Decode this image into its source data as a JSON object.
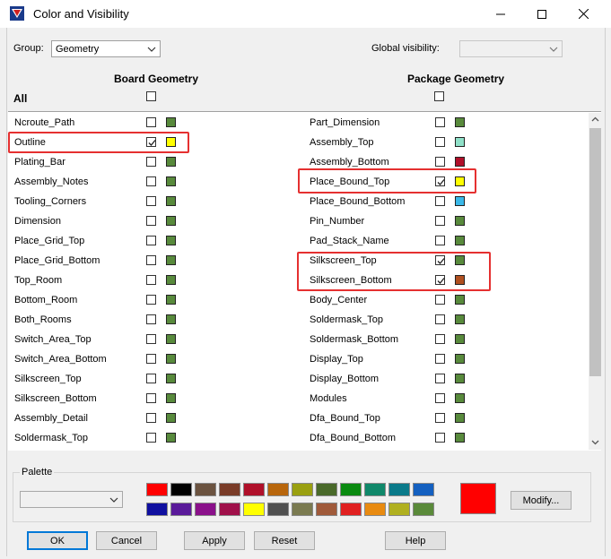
{
  "window": {
    "title": "Color and Visibility"
  },
  "group": {
    "label": "Group:",
    "value": "Geometry"
  },
  "global_visibility": {
    "label": "Global visibility:",
    "value": ""
  },
  "headers": {
    "left": "Board Geometry",
    "right": "Package Geometry",
    "all": "All"
  },
  "left_items": [
    {
      "label": "Ncroute_Path",
      "checked": false,
      "color": "#588a3c"
    },
    {
      "label": "Outline",
      "checked": true,
      "color": "#ffff00"
    },
    {
      "label": "Plating_Bar",
      "checked": false,
      "color": "#588a3c"
    },
    {
      "label": "Assembly_Notes",
      "checked": false,
      "color": "#588a3c"
    },
    {
      "label": "Tooling_Corners",
      "checked": false,
      "color": "#588a3c"
    },
    {
      "label": "Dimension",
      "checked": false,
      "color": "#588a3c"
    },
    {
      "label": "Place_Grid_Top",
      "checked": false,
      "color": "#588a3c"
    },
    {
      "label": "Place_Grid_Bottom",
      "checked": false,
      "color": "#588a3c"
    },
    {
      "label": "Top_Room",
      "checked": false,
      "color": "#588a3c"
    },
    {
      "label": "Bottom_Room",
      "checked": false,
      "color": "#588a3c"
    },
    {
      "label": "Both_Rooms",
      "checked": false,
      "color": "#588a3c"
    },
    {
      "label": "Switch_Area_Top",
      "checked": false,
      "color": "#588a3c"
    },
    {
      "label": "Switch_Area_Bottom",
      "checked": false,
      "color": "#588a3c"
    },
    {
      "label": "Silkscreen_Top",
      "checked": false,
      "color": "#588a3c"
    },
    {
      "label": "Silkscreen_Bottom",
      "checked": false,
      "color": "#588a3c"
    },
    {
      "label": "Assembly_Detail",
      "checked": false,
      "color": "#588a3c"
    },
    {
      "label": "Soldermask_Top",
      "checked": false,
      "color": "#588a3c"
    }
  ],
  "right_items": [
    {
      "label": "Part_Dimension",
      "checked": false,
      "color": "#588a3c"
    },
    {
      "label": "Assembly_Top",
      "checked": false,
      "color": "#8fe0c8"
    },
    {
      "label": "Assembly_Bottom",
      "checked": false,
      "color": "#b0102a"
    },
    {
      "label": "Place_Bound_Top",
      "checked": true,
      "color": "#ffff00"
    },
    {
      "label": "Place_Bound_Bottom",
      "checked": false,
      "color": "#3ab8e8"
    },
    {
      "label": "Pin_Number",
      "checked": false,
      "color": "#588a3c"
    },
    {
      "label": "Pad_Stack_Name",
      "checked": false,
      "color": "#588a3c"
    },
    {
      "label": "Silkscreen_Top",
      "checked": true,
      "color": "#588a3c"
    },
    {
      "label": "Silkscreen_Bottom",
      "checked": true,
      "color": "#b05020"
    },
    {
      "label": "Body_Center",
      "checked": false,
      "color": "#588a3c"
    },
    {
      "label": "Soldermask_Top",
      "checked": false,
      "color": "#588a3c"
    },
    {
      "label": "Soldermask_Bottom",
      "checked": false,
      "color": "#588a3c"
    },
    {
      "label": "Display_Top",
      "checked": false,
      "color": "#588a3c"
    },
    {
      "label": "Display_Bottom",
      "checked": false,
      "color": "#588a3c"
    },
    {
      "label": "Modules",
      "checked": false,
      "color": "#588a3c"
    },
    {
      "label": "Dfa_Bound_Top",
      "checked": false,
      "color": "#588a3c"
    },
    {
      "label": "Dfa_Bound_Bottom",
      "checked": false,
      "color": "#588a3c"
    }
  ],
  "palette": {
    "label": "Palette",
    "row1": [
      "#ff0000",
      "#000000",
      "#6b5340",
      "#7a3c28",
      "#b0102a",
      "#b8660c",
      "#9aa010",
      "#4a6a2a",
      "#0a8a10",
      "#10886a",
      "#0a7a8a",
      "#1460c0"
    ],
    "row2": [
      "#1010a0",
      "#5a1a9a",
      "#8a108a",
      "#a0104a",
      "#ffff00",
      "#505050",
      "#7a7a50",
      "#a05a3a",
      "#e02020",
      "#e88a10",
      "#b0b020",
      "#5a8a3a"
    ],
    "current": "#ff0000",
    "modify_label": "Modify..."
  },
  "buttons": {
    "ok": "OK",
    "cancel": "Cancel",
    "apply": "Apply",
    "reset": "Reset",
    "help": "Help"
  }
}
